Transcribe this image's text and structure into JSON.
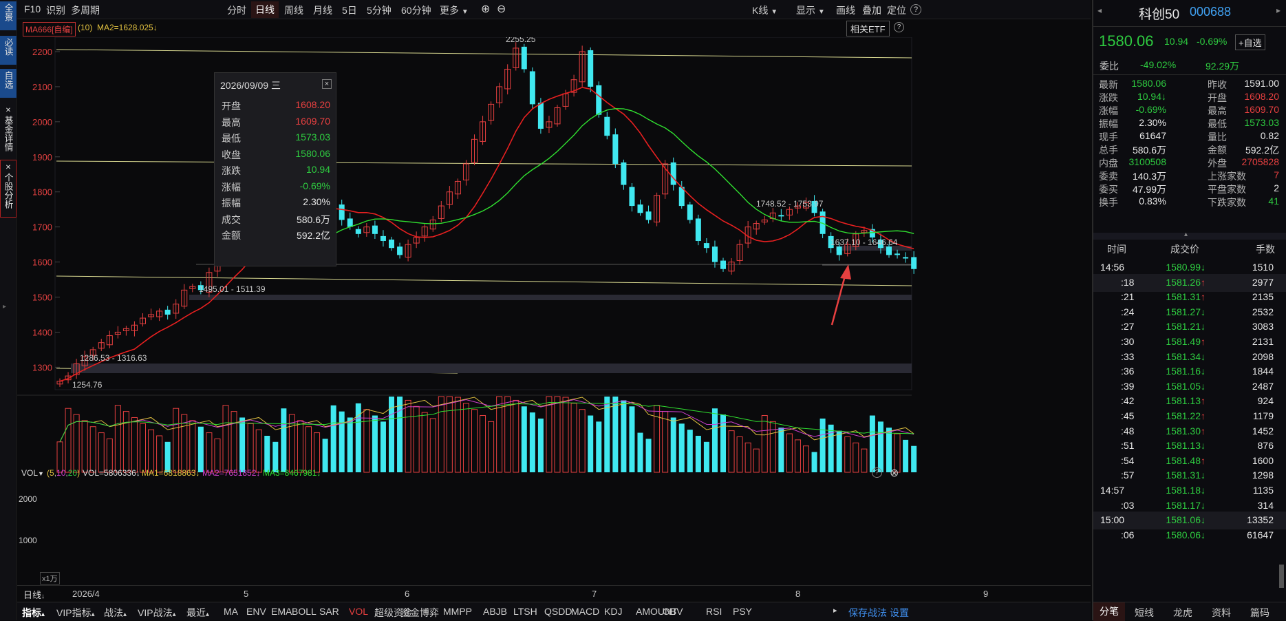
{
  "leftbar": {
    "items": [
      "全景",
      "必读",
      "自选",
      "基金详情",
      "个股分析"
    ]
  },
  "topbar": {
    "left": [
      "F10",
      "识别",
      "多周期"
    ],
    "periods": [
      "分时",
      "日线",
      "周线",
      "月线",
      "5日",
      "5分钟",
      "60分钟",
      "更多"
    ],
    "selected": "日线",
    "zoom_in": "⊕",
    "zoom_out": "⊖",
    "right": [
      "K线",
      "显示",
      "画线",
      "叠加",
      "定位"
    ],
    "help": "?"
  },
  "indbar": {
    "ma_name": "MA666[自编]",
    "ma_param": "(10)",
    "ma2": "MA2=1628.025↓",
    "etf": "相关ETF",
    "help": "?"
  },
  "chart": {
    "yticks": [
      "2200",
      "2100",
      "2000",
      "1900",
      "1800",
      "1700",
      "1600",
      "1500",
      "1400",
      "1300"
    ],
    "max_label": "2255.25",
    "min_label": "1254.76",
    "zones": [
      "1748.52 - 1753.97",
      "1637.10 - 1646.64",
      "1495.01 - 1511.39",
      "1286.53 - 1316.63"
    ]
  },
  "tooltip": {
    "date": "2026/09/09 三",
    "close_icon": "×",
    "rows": [
      {
        "label": "开盘",
        "value": "1608.20",
        "color": "red"
      },
      {
        "label": "最高",
        "value": "1609.70",
        "color": "red"
      },
      {
        "label": "最低",
        "value": "1573.03",
        "color": "green"
      },
      {
        "label": "收盘",
        "value": "1580.06",
        "color": "green"
      },
      {
        "label": "涨跌",
        "value": "10.94",
        "color": "green"
      },
      {
        "label": "涨幅",
        "value": "-0.69%",
        "color": "green"
      },
      {
        "label": "振幅",
        "value": "2.30%",
        "color": "white"
      },
      {
        "label": "成交",
        "value": "580.6万",
        "color": "white"
      },
      {
        "label": "金额",
        "value": "592.2亿",
        "color": "white"
      }
    ]
  },
  "volbar": {
    "name": "VOL",
    "params_open": "(",
    "p1": "5",
    "p2": "10",
    "p3": "20",
    "params_close": ")",
    "vol": "VOL=5806336↓",
    "ma1": "MA1=6818863↓",
    "ma2": "MA2=7651852↓",
    "ma3": "MA3=8467981↓",
    "help": "?",
    "close": "⊗",
    "yticks": [
      "2000",
      "1000"
    ],
    "unit": "x1万"
  },
  "xaxis": {
    "toggle": "日线",
    "labels": [
      "2026/4",
      "5",
      "6",
      "7",
      "8",
      "9"
    ]
  },
  "bottombar": {
    "items": [
      "指标",
      "VIP指标",
      "战法",
      "VIP战法",
      "最近",
      "MA",
      "ENV",
      "EMA",
      "BOLL",
      "SAR",
      "VOL",
      "超级资金",
      "资金博弈",
      "MMPP",
      "ABJB",
      "LTSH",
      "QSDD",
      "MACD",
      "KDJ",
      "AMOUNT",
      "OBV",
      "RSI",
      "PSY"
    ],
    "save": "保存战法",
    "settings": "设置"
  },
  "stock": {
    "name": "科创50",
    "code": "000688",
    "price": "1580.06",
    "change": "10.94",
    "pct": "-0.69%",
    "add_fav": "+自选",
    "weibi_label": "委比",
    "weibi": "-49.02%",
    "weicha": "92.29万",
    "quote": [
      [
        "最新",
        "1580.06",
        "green",
        "昨收",
        "1591.00",
        "white"
      ],
      [
        "涨跌",
        "10.94↓",
        "green",
        "开盘",
        "1608.20",
        "red"
      ],
      [
        "涨幅",
        "-0.69%",
        "green",
        "最高",
        "1609.70",
        "red"
      ],
      [
        "振幅",
        "2.30%",
        "white",
        "最低",
        "1573.03",
        "green"
      ],
      [
        "现手",
        "61647",
        "white",
        "量比",
        "0.82",
        "white"
      ],
      [
        "总手",
        "580.6万",
        "white",
        "金额",
        "592.2亿",
        "white"
      ],
      [
        "内盘",
        "3100508",
        "green",
        "外盘",
        "2705828",
        "red"
      ],
      [
        "委卖",
        "140.3万",
        "white",
        "上涨家数",
        "7",
        "red"
      ],
      [
        "委买",
        "47.99万",
        "white",
        "平盘家数",
        "2",
        "white"
      ],
      [
        "换手",
        "0.83%",
        "white",
        "下跌家数",
        "41",
        "green"
      ]
    ],
    "tick_header": [
      "时间",
      "成交价",
      "手数"
    ],
    "ticks": [
      [
        "14:56",
        "1580.99",
        "↓",
        "1510"
      ],
      [
        ":18",
        "1581.26",
        "↑",
        "2977"
      ],
      [
        ":21",
        "1581.31",
        "↑",
        "2135"
      ],
      [
        ":24",
        "1581.27",
        "↓",
        "2532"
      ],
      [
        ":27",
        "1581.21",
        "↓",
        "3083"
      ],
      [
        ":30",
        "1581.49",
        "↑",
        "2131"
      ],
      [
        ":33",
        "1581.34",
        "↓",
        "2098"
      ],
      [
        ":36",
        "1581.16",
        "↓",
        "1844"
      ],
      [
        ":39",
        "1581.05",
        "↓",
        "2487"
      ],
      [
        ":42",
        "1581.13",
        "↑",
        "924"
      ],
      [
        ":45",
        "1581.22",
        "↑",
        "1179"
      ],
      [
        ":48",
        "1581.30",
        "↑",
        "1452"
      ],
      [
        ":51",
        "1581.13",
        "↓",
        "876"
      ],
      [
        ":54",
        "1581.48",
        "↑",
        "1600"
      ],
      [
        ":57",
        "1581.31",
        "↓",
        "1298"
      ],
      [
        "14:57",
        "1581.18",
        "↓",
        "1135"
      ],
      [
        ":03",
        "1581.17",
        "↓",
        "314"
      ],
      [
        "15:00",
        "1581.06",
        "↓",
        "13352"
      ],
      [
        ":06",
        "1580.06",
        "↓",
        "61647"
      ]
    ],
    "tabs": [
      "分笔",
      "短线",
      "龙虎",
      "资料",
      "篇码"
    ]
  },
  "colors": {
    "up": "#e84040",
    "down": "#40e8f0",
    "ma10": "#e82020",
    "ma20": "#30e030",
    "bg": "#0a0a0c"
  }
}
